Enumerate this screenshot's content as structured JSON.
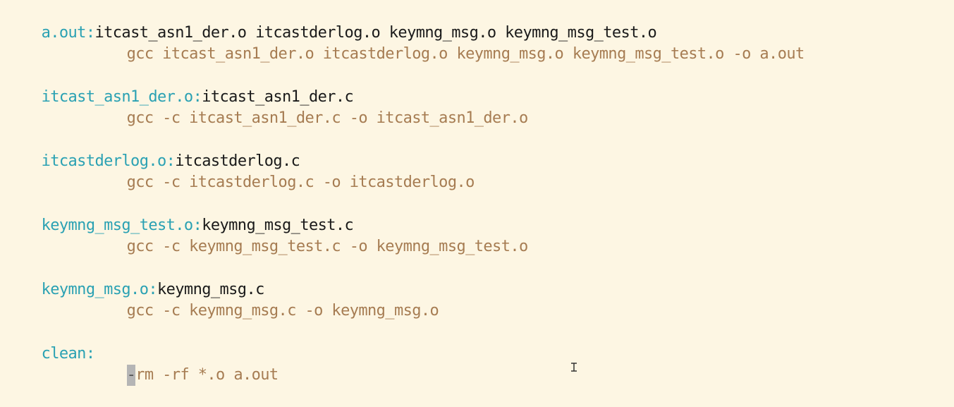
{
  "editor": {
    "rules": [
      {
        "target": "a.out",
        "sep": ":",
        "deps": "itcast_asn1_der.o itcastderlog.o keymng_msg.o keymng_msg_test.o",
        "recipe": "gcc itcast_asn1_der.o itcastderlog.o keymng_msg.o keymng_msg_test.o -o a.out"
      },
      {
        "target": "itcast_asn1_der.o",
        "sep": ":",
        "deps": "itcast_asn1_der.c",
        "recipe": "gcc -c itcast_asn1_der.c -o itcast_asn1_der.o"
      },
      {
        "target": "itcastderlog.o",
        "sep": ":",
        "deps": "itcastderlog.c",
        "recipe": "gcc -c itcastderlog.c -o itcastderlog.o"
      },
      {
        "target": "keymng_msg_test.o",
        "sep": ":",
        "deps": "keymng_msg_test.c",
        "recipe": "gcc -c keymng_msg_test.c -o keymng_msg_test.o"
      },
      {
        "target": "keymng_msg.o",
        "sep": ":",
        "deps": "keymng_msg.c",
        "recipe": "gcc -c keymng_msg.c -o keymng_msg.o"
      },
      {
        "target": "clean",
        "sep": ":",
        "deps": "",
        "cursor_char": "-",
        "recipe_rest": "rm -rf *.o a.out"
      }
    ],
    "colors": {
      "background": "#fdf6e3",
      "target": "#2aa1b3",
      "dependencies": "#1a1a1a",
      "recipe": "#a67c52",
      "cursor": "#b5b5b5"
    },
    "mouse_cursor_icon": "text-ibeam-icon"
  }
}
